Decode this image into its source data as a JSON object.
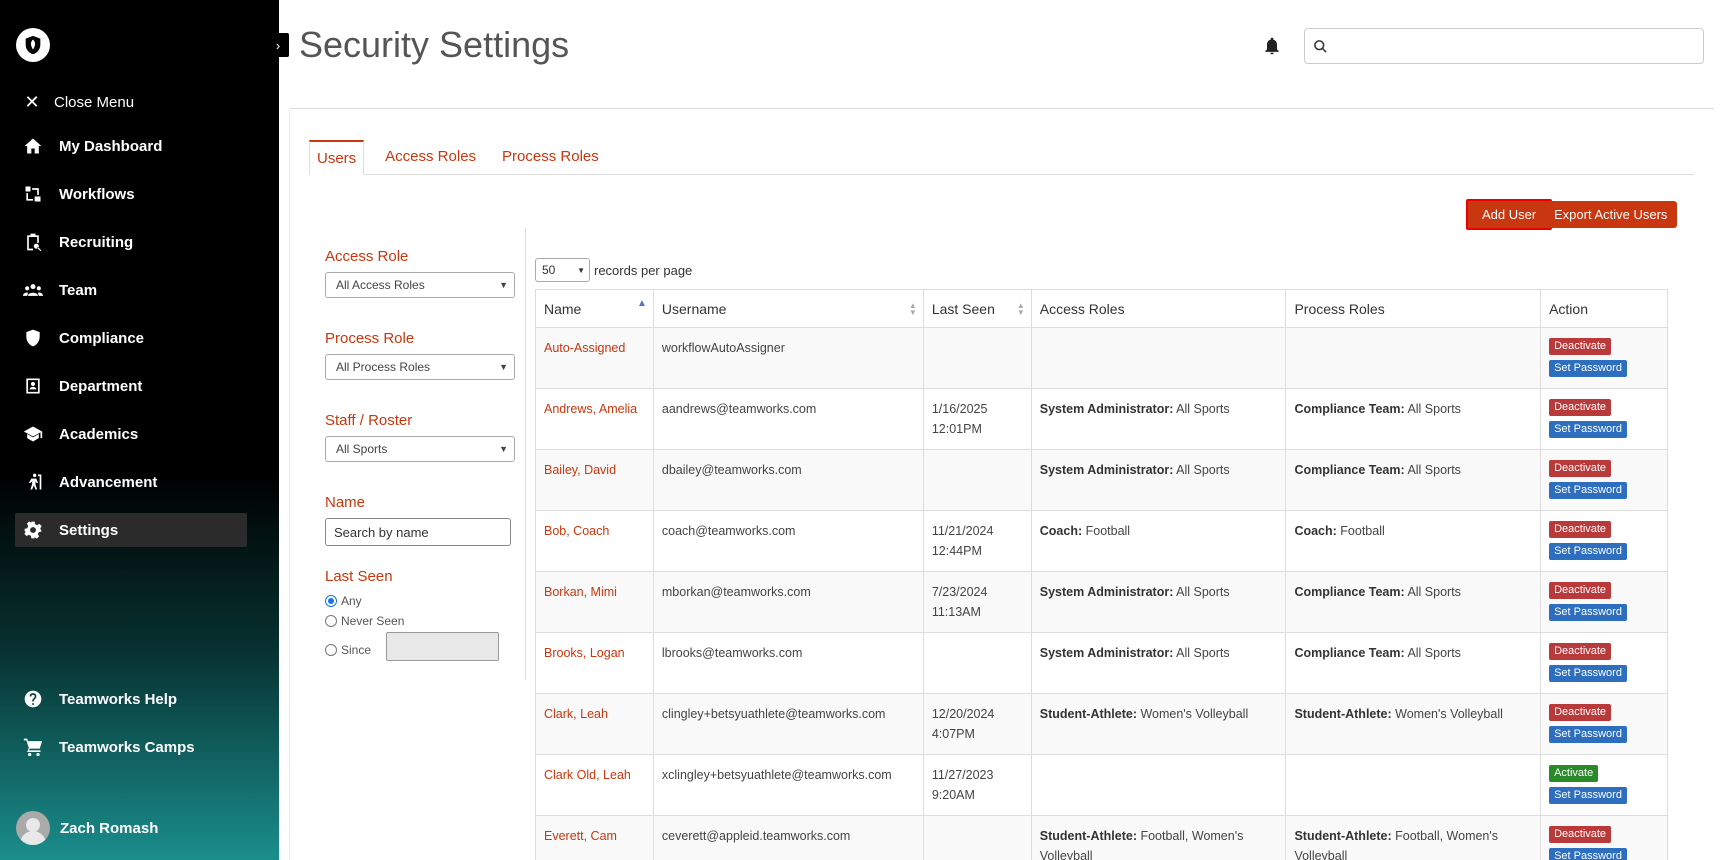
{
  "app": {
    "page_title": "Security Settings"
  },
  "sidebar": {
    "close_menu": "Close Menu",
    "items": [
      {
        "label": "My Dashboard",
        "icon": "home-icon"
      },
      {
        "label": "Workflows",
        "icon": "workflow-icon"
      },
      {
        "label": "Recruiting",
        "icon": "clipboard-search-icon"
      },
      {
        "label": "Team",
        "icon": "people-icon"
      },
      {
        "label": "Compliance",
        "icon": "shield-icon"
      },
      {
        "label": "Department",
        "icon": "id-card-icon"
      },
      {
        "label": "Academics",
        "icon": "graduation-cap-icon"
      },
      {
        "label": "Advancement",
        "icon": "stairs-person-icon"
      },
      {
        "label": "Settings",
        "icon": "gear-icon",
        "active": true
      }
    ],
    "help": "Teamworks Help",
    "camps": "Teamworks Camps",
    "user_name": "Zach Romash"
  },
  "search": {
    "placeholder": ""
  },
  "tabs": [
    "Users",
    "Access Roles",
    "Process Roles"
  ],
  "buttons": {
    "add_user": "Add User",
    "export": "Export Active Users"
  },
  "filters": {
    "access_role_label": "Access Role",
    "access_role_value": "All Access Roles",
    "process_role_label": "Process Role",
    "process_role_value": "All Process Roles",
    "staff_label": "Staff / Roster",
    "staff_value": "All Sports",
    "name_label": "Name",
    "name_placeholder": "Search by name",
    "last_seen_label": "Last Seen",
    "opt_any": "Any",
    "opt_never": "Never Seen",
    "opt_since": "Since"
  },
  "records": {
    "value": "50",
    "label": "records per page"
  },
  "table": {
    "headers": [
      "Name",
      "Username",
      "Last Seen",
      "Access Roles",
      "Process Roles",
      "Action"
    ],
    "rows": [
      {
        "name": "Auto-Assigned",
        "username": "workflowAutoAssigner",
        "seen1": "",
        "seen2": "",
        "ar_b": "",
        "ar": "",
        "pr_b": "",
        "pr": "",
        "btn1": "Deactivate",
        "btn1_type": "deact",
        "btn2": "Set Password"
      },
      {
        "name": "Andrews, Amelia",
        "username": "aandrews@teamworks.com",
        "seen1": "1/16/2025",
        "seen2": "12:01PM",
        "ar_b": "System Administrator:",
        "ar": " All Sports",
        "pr_b": "Compliance Team:",
        "pr": " All Sports",
        "btn1": "Deactivate",
        "btn1_type": "deact",
        "btn2": "Set Password"
      },
      {
        "name": "Bailey, David",
        "username": "dbailey@teamworks.com",
        "seen1": "",
        "seen2": "",
        "ar_b": "System Administrator:",
        "ar": " All Sports",
        "pr_b": "Compliance Team:",
        "pr": " All Sports",
        "btn1": "Deactivate",
        "btn1_type": "deact",
        "btn2": "Set Password"
      },
      {
        "name": "Bob, Coach",
        "username": "coach@teamworks.com",
        "seen1": "11/21/2024",
        "seen2": "12:44PM",
        "ar_b": "Coach:",
        "ar": " Football",
        "pr_b": "Coach:",
        "pr": " Football",
        "btn1": "Deactivate",
        "btn1_type": "deact",
        "btn2": "Set Password"
      },
      {
        "name": "Borkan, Mimi",
        "username": "mborkan@teamworks.com",
        "seen1": "7/23/2024",
        "seen2": "11:13AM",
        "ar_b": "System Administrator:",
        "ar": " All Sports",
        "pr_b": "Compliance Team:",
        "pr": " All Sports",
        "btn1": "Deactivate",
        "btn1_type": "deact",
        "btn2": "Set Password"
      },
      {
        "name": "Brooks, Logan",
        "username": "lbrooks@teamworks.com",
        "seen1": "",
        "seen2": "",
        "ar_b": "System Administrator:",
        "ar": " All Sports",
        "pr_b": "Compliance Team:",
        "pr": " All Sports",
        "btn1": "Deactivate",
        "btn1_type": "deact",
        "btn2": "Set Password"
      },
      {
        "name": "Clark, Leah",
        "username": "clingley+betsyuathlete@teamworks.com",
        "seen1": "12/20/2024",
        "seen2": "4:07PM",
        "ar_b": "Student-Athlete:",
        "ar": " Women's Volleyball",
        "pr_b": "Student-Athlete:",
        "pr": " Women's Volleyball",
        "btn1": "Deactivate",
        "btn1_type": "deact",
        "btn2": "Set Password"
      },
      {
        "name": "Clark Old, Leah",
        "username": "xclingley+betsyuathlete@teamworks.com",
        "seen1": "11/27/2023",
        "seen2": "9:20AM",
        "ar_b": "",
        "ar": "",
        "pr_b": "",
        "pr": "",
        "btn1": "Activate",
        "btn1_type": "act",
        "btn2": "Set Password"
      },
      {
        "name": "Everett, Cam",
        "username": "ceverett@appleid.teamworks.com",
        "seen1": "",
        "seen2": "",
        "ar_b": "Student-Athlete:",
        "ar": " Football, Women's Volleyball",
        "pr_b": "Student-Athlete:",
        "pr": " Football, Women's Volleyball",
        "btn1": "Deactivate",
        "btn1_type": "deact",
        "btn2": "Set Password"
      }
    ]
  }
}
